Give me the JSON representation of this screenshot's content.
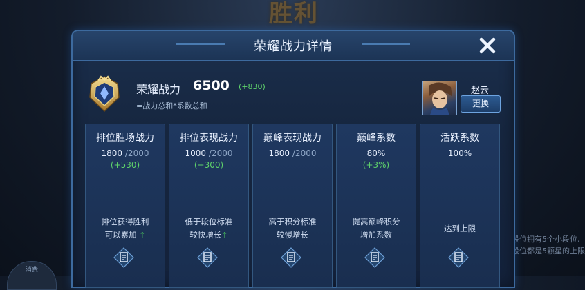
{
  "background": {
    "victory_text": "胜利",
    "side_text_1": "段位拥有5个小段位,",
    "side_text_2": "段位都是5颗星的上限",
    "left_badge": "消费"
  },
  "panel": {
    "title": "荣耀战力详情",
    "close_icon": "close-icon"
  },
  "summary": {
    "label": "荣耀战力",
    "value": "6500",
    "delta": "(+830)",
    "formula": "=战力总和*系数总和"
  },
  "hero": {
    "name": "赵云",
    "change_label": "更换"
  },
  "cards": [
    {
      "title": "排位胜场战力",
      "value": "1800",
      "max": "/2000",
      "delta": "(+530)",
      "desc1": "排位获得胜利",
      "desc2": "可以累加",
      "arrow": "↑"
    },
    {
      "title": "排位表现战力",
      "value": "1000",
      "max": "/2000",
      "delta": "(+300)",
      "desc1": "低于段位标准",
      "desc2": "较快增长",
      "arrow": "↑"
    },
    {
      "title": "巅峰表现战力",
      "value": "1800",
      "max": "/2000",
      "delta": "",
      "desc1": "高于积分标准",
      "desc2": "较慢增长",
      "arrow": ""
    },
    {
      "title": "巅峰系数",
      "value": "80%",
      "max": "",
      "delta": "(+3%)",
      "desc1": "提高巅峰积分",
      "desc2": "增加系数",
      "arrow": ""
    },
    {
      "title": "活跃系数",
      "value": "100%",
      "max": "",
      "delta": "",
      "desc1": "达到上限",
      "desc2": "",
      "arrow": ""
    }
  ],
  "colors": {
    "accent_green": "#5fd36b",
    "panel_border": "#3d6a9e",
    "card_bg": "#1f3860"
  }
}
